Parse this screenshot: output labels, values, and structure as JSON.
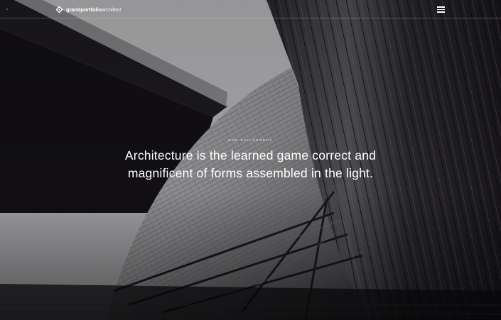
{
  "header": {
    "logo_name": "grandportfolio",
    "logo_suffix": "architect",
    "logo_icon": "diamond-logo-icon",
    "menu_icon": "hamburger-menu-icon"
  },
  "hero": {
    "eyebrow": "OUR PHILOSOPHY",
    "headline_line1": "Architecture is the learned game correct and",
    "headline_line2": "magnificent of forms assembled in the light."
  },
  "colors": {
    "background": "#1a181c",
    "text": "#ffffff",
    "header_border": "rgba(255,255,255,0.22)"
  }
}
